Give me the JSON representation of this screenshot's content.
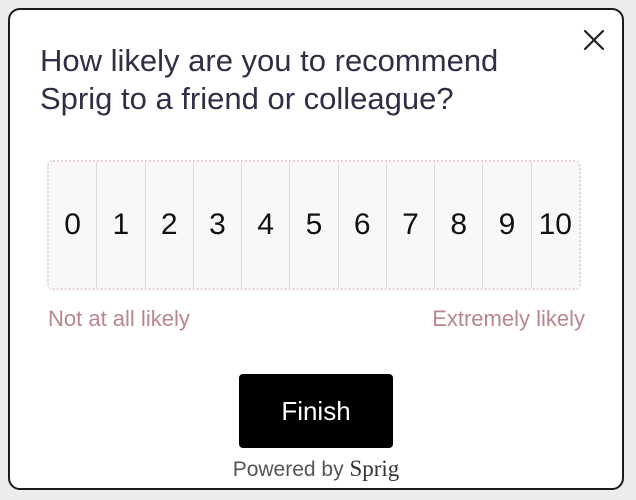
{
  "survey": {
    "question": "How likely are you to recommend Sprig to a friend or colleague?",
    "scale": [
      "0",
      "1",
      "2",
      "3",
      "4",
      "5",
      "6",
      "7",
      "8",
      "9",
      "10"
    ],
    "low_label": "Not at all likely",
    "high_label": "Extremely likely",
    "finish_label": "Finish",
    "powered_by_text": "Powered by",
    "brand_name": "Sprig"
  },
  "icons": {
    "close": "close-icon"
  },
  "colors": {
    "question_text": "#2f2f45",
    "scale_label": "#b8868c",
    "button_bg": "#000000",
    "button_text": "#ffffff"
  }
}
